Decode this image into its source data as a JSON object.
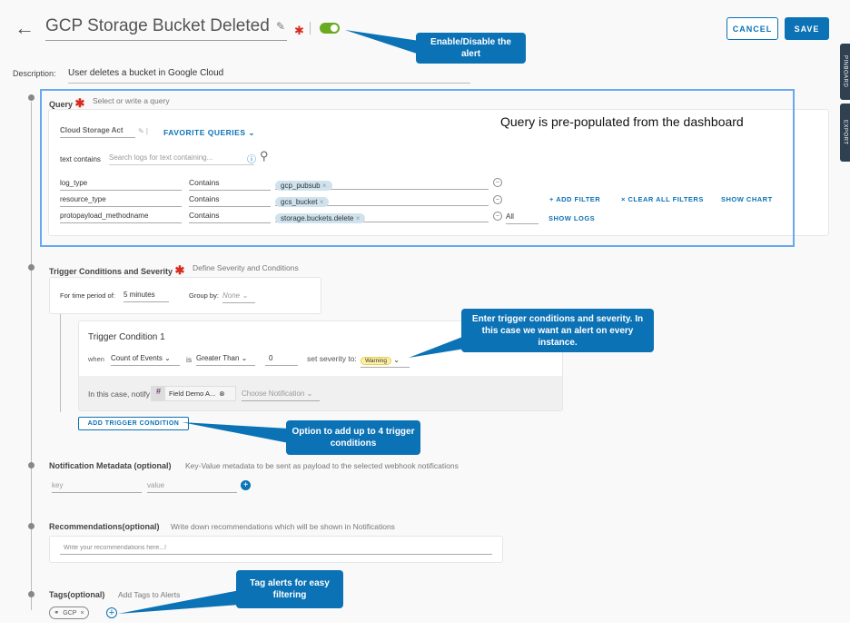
{
  "header": {
    "title": "GCP Storage Bucket Deleted",
    "enabled": true,
    "cancel": "CANCEL",
    "save": "SAVE"
  },
  "description": {
    "label": "Description:",
    "value": "User deletes a bucket in Google Cloud"
  },
  "side_tabs": [
    "PINBOARD",
    "EXPORT"
  ],
  "query": {
    "label": "Query",
    "hint": "Select or write a query",
    "name": "Cloud Storage Act",
    "favorites": "FAVORITE QUERIES",
    "text_label": "text contains",
    "search_placeholder": "Search logs for text containing...",
    "filters": [
      {
        "field": "log_type",
        "op": "Contains",
        "value": "gcp_pubsub"
      },
      {
        "field": "resource_type",
        "op": "Contains",
        "value": "gcs_bucket"
      },
      {
        "field": "protopayload_methodname",
        "op": "Contains",
        "value": "storage.buckets.delete"
      }
    ],
    "match": "All",
    "add_filter": "ADD FILTER",
    "clear_filters": "CLEAR ALL FILTERS",
    "show_chart": "SHOW CHART",
    "show_logs": "SHOW LOGS"
  },
  "trigger": {
    "label": "Trigger Conditions and Severity",
    "hint": "Define Severity and Conditions",
    "period_label": "For time period of:",
    "period": "5 minutes",
    "group_label": "Group by:",
    "group": "None",
    "condition_title": "Trigger Condition 1",
    "when": "when",
    "metric": "Count of Events",
    "is": "is",
    "comparator": "Greater Than",
    "threshold": "0",
    "severity_label": "set severity to:",
    "severity": "Warning",
    "notify_label": "In this case, notify",
    "notify_target": "Field Demo A...",
    "choose_notification": "Choose Notification",
    "add_condition": "ADD TRIGGER CONDITION"
  },
  "metadata": {
    "label": "Notification Metadata (optional)",
    "hint": "Key-Value metadata to be sent as payload to the selected webhook notifications",
    "key_placeholder": "key",
    "value_placeholder": "value"
  },
  "recommendations": {
    "label": "Recommendations(optional)",
    "hint": "Write down recommendations which will be shown in Notifications",
    "placeholder": "Write your recommendations here...!"
  },
  "tags": {
    "label": "Tags(optional)",
    "hint": "Add Tags to Alerts",
    "items": [
      "GCP"
    ]
  },
  "annotations": {
    "toggle": "Enable/Disable the alert",
    "query": "Query is pre-populated from the dashboard",
    "trigger": "Enter trigger conditions and severity. In this case we want an alert on every instance.",
    "add_condition": "Option to add up to 4 trigger conditions",
    "tags": "Tag alerts for easy filtering"
  },
  "colors": {
    "accent": "#0b72b5",
    "toggle": "#6aaa1e",
    "highlight": "#6aa7f0"
  }
}
